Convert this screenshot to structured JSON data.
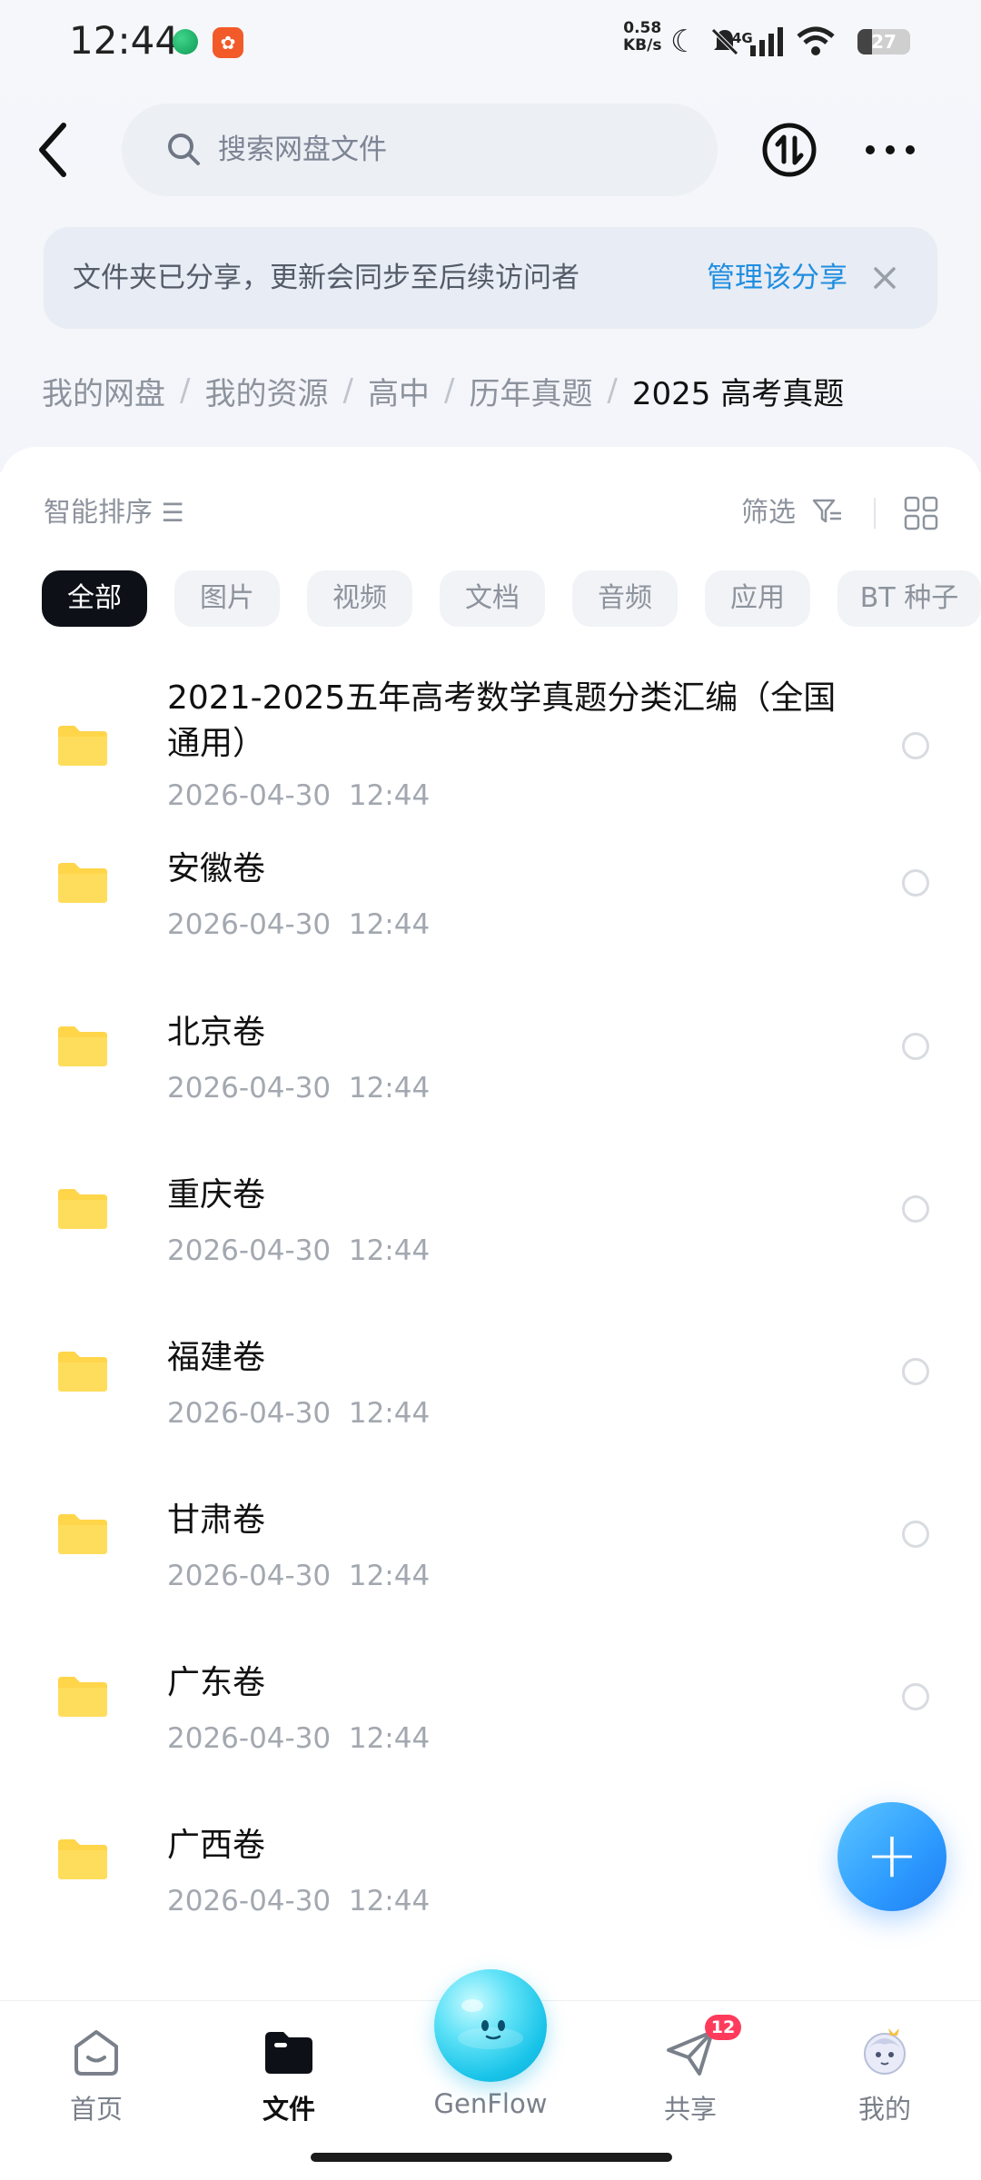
{
  "status_bar": {
    "time": "12:44",
    "net_speed": "0.58",
    "net_unit": "KB/s",
    "network": "4G",
    "battery": "27"
  },
  "header": {
    "search_placeholder": "搜索网盘文件"
  },
  "share_banner": {
    "text": "文件夹已分享，更新会同步至后续访问者",
    "manage_label": "管理该分享"
  },
  "breadcrumb": [
    "我的网盘",
    "我的资源",
    "高中",
    "历年真题",
    "2025 高考真题"
  ],
  "toolbar": {
    "sort_label": "智能排序",
    "filter_label": "筛选"
  },
  "chips": [
    "全部",
    "图片",
    "视频",
    "文档",
    "音频",
    "应用",
    "BT 种子"
  ],
  "active_chip": "全部",
  "files": [
    {
      "name": "2021-2025五年高考数学真题分类汇编（全国通用）",
      "date": "2026-04-30  12:44"
    },
    {
      "name": "安徽卷",
      "date": "2026-04-30  12:44"
    },
    {
      "name": "北京卷",
      "date": "2026-04-30  12:44"
    },
    {
      "name": "重庆卷",
      "date": "2026-04-30  12:44"
    },
    {
      "name": "福建卷",
      "date": "2026-04-30  12:44"
    },
    {
      "name": "甘肃卷",
      "date": "2026-04-30  12:44"
    },
    {
      "name": "广东卷",
      "date": "2026-04-30  12:44"
    },
    {
      "name": "广西卷",
      "date": "2026-04-30  12:44"
    }
  ],
  "bottom_nav": {
    "home": "首页",
    "files": "文件",
    "genflow": "GenFlow",
    "share": "共享",
    "share_badge": "12",
    "mine": "我的"
  },
  "colors": {
    "accent_blue": "#1f8ee0",
    "folder_yellow": "#ffd54a",
    "badge_red": "#ff3b5c"
  }
}
